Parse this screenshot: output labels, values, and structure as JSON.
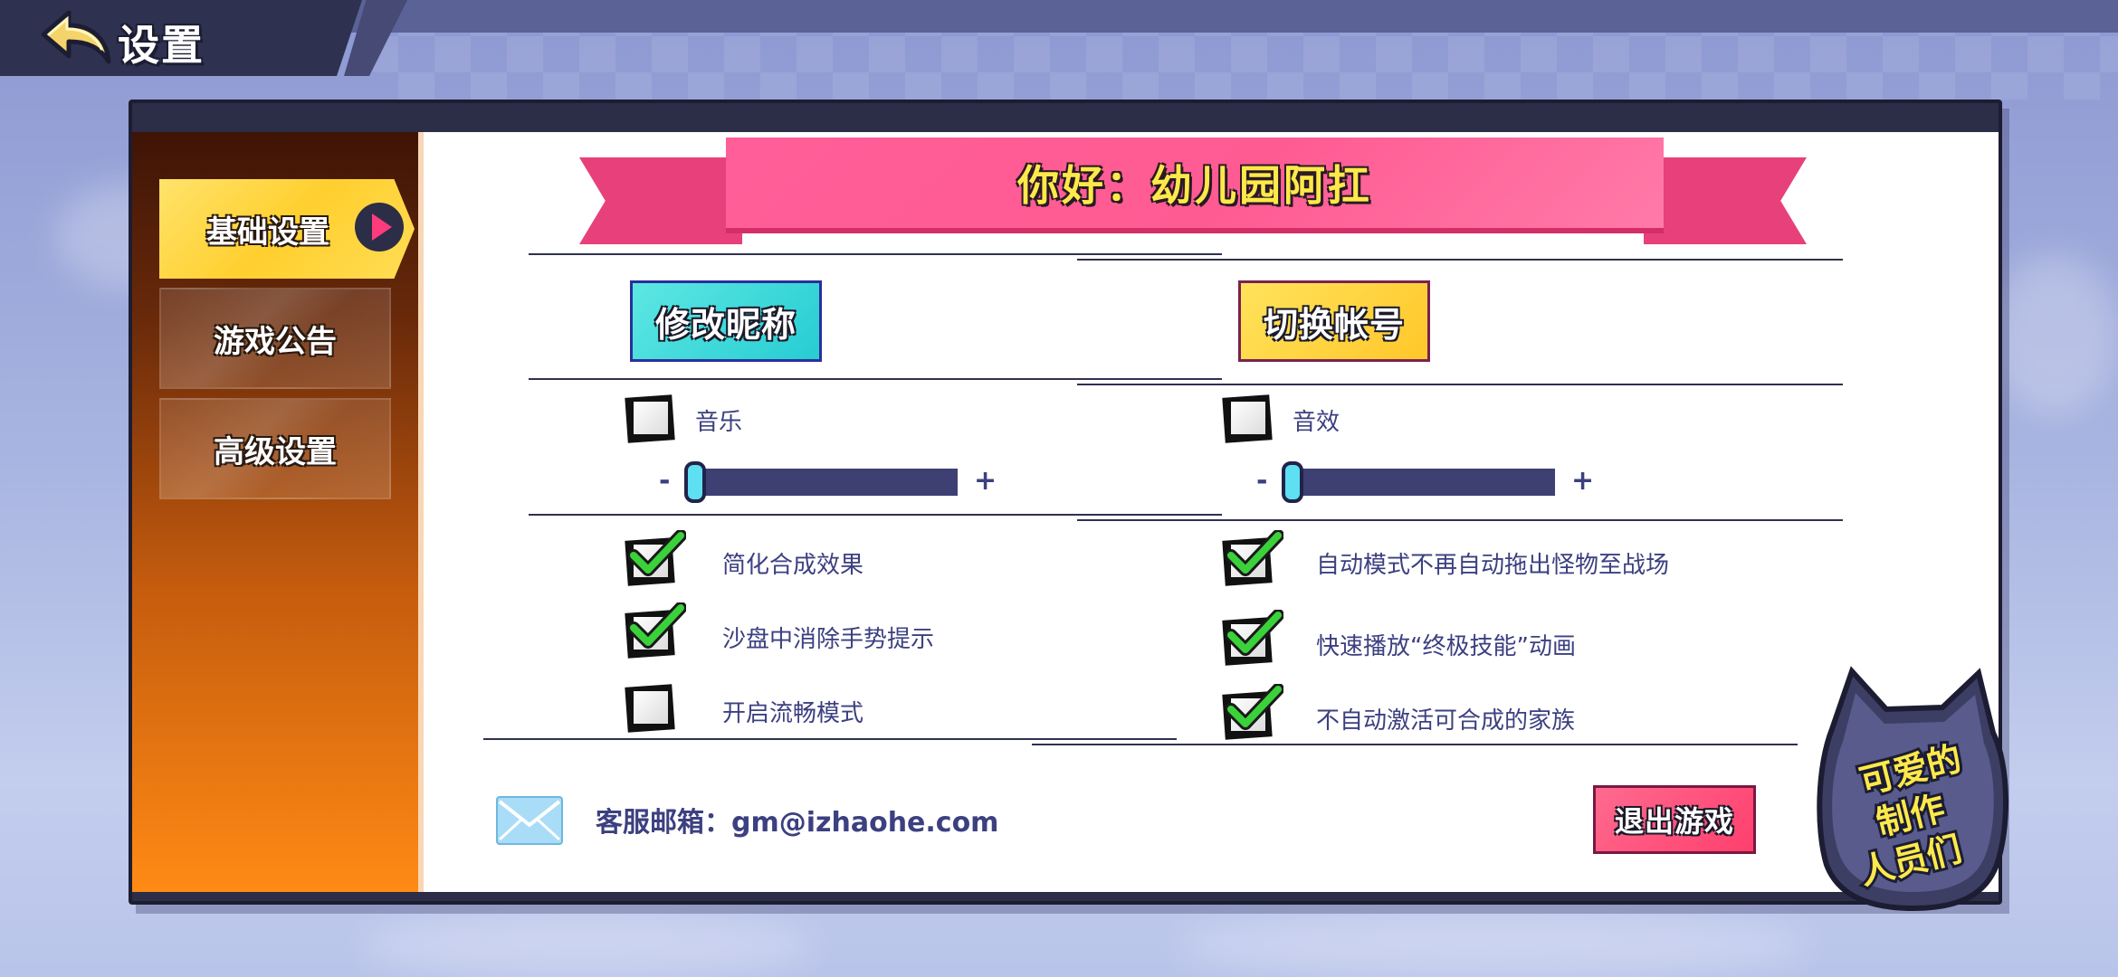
{
  "header": {
    "title": "设置",
    "back_icon": "back-arrow-icon"
  },
  "sidebar": {
    "tabs": [
      {
        "label": "基础设置",
        "active": true
      },
      {
        "label": "游戏公告",
        "active": false
      },
      {
        "label": "高级设置",
        "active": false
      }
    ]
  },
  "banner": {
    "greeting": "你好：幼儿园阿扛"
  },
  "buttons": {
    "change_nickname": "修改昵称",
    "switch_account": "切换帐号",
    "exit_game": "退出游戏"
  },
  "audio": {
    "music": {
      "label": "音乐",
      "enabled": false,
      "level": 0.0,
      "minus": "-",
      "plus": "+"
    },
    "sfx": {
      "label": "音效",
      "enabled": false,
      "level": 0.0,
      "minus": "-",
      "plus": "+"
    }
  },
  "options": [
    {
      "label": "简化合成效果",
      "checked": true
    },
    {
      "label": "沙盘中消除手势提示",
      "checked": true
    },
    {
      "label": "开启流畅模式",
      "checked": false
    },
    {
      "label": "自动模式不再自动拖出怪物至战场",
      "checked": true
    },
    {
      "label": "快速播放“终极技能”动画",
      "checked": true
    },
    {
      "label": "不自动激活可合成的家族",
      "checked": true
    }
  ],
  "footer": {
    "email_label": "客服邮箱：gm@izhaohe.com",
    "mail_icon": "mail-icon"
  },
  "credits": {
    "line1": "可爱的",
    "line2": "制作",
    "line3": "人员们"
  },
  "colors": {
    "accent_pink": "#ff5b93",
    "accent_yellow": "#ffe94a",
    "accent_cyan": "#26cdd3",
    "text_blue": "#3c4080",
    "check_green": "#3ad13a"
  }
}
